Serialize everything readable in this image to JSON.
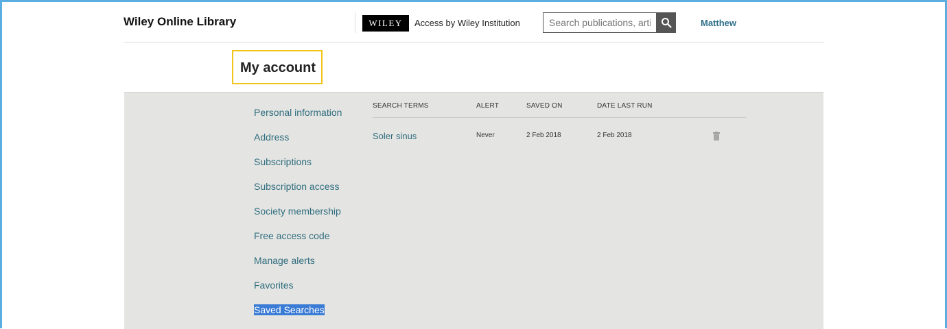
{
  "header": {
    "brand": "Wiley Online Library",
    "logo_text": "WILEY",
    "access_text": "Access by Wiley Institution",
    "search_placeholder": "Search publications, articles",
    "user_name": "Matthew"
  },
  "page": {
    "title": "My account"
  },
  "sidebar": {
    "items": [
      {
        "label": "Personal information"
      },
      {
        "label": "Address"
      },
      {
        "label": "Subscriptions"
      },
      {
        "label": "Subscription access"
      },
      {
        "label": "Society membership"
      },
      {
        "label": "Free access code"
      },
      {
        "label": "Manage alerts"
      },
      {
        "label": "Favorites"
      },
      {
        "label": "Saved Searches"
      }
    ],
    "selected": "Saved Searches"
  },
  "saved_searches": {
    "columns": [
      "SEARCH TERMS",
      "ALERT",
      "SAVED ON",
      "DATE LAST RUN"
    ],
    "rows": [
      {
        "search_terms": "Soler sinus",
        "alert": "Never",
        "saved_on": "2 Feb 2018",
        "date_last_run": "2 Feb 2018",
        "action_icon": "trash-icon"
      }
    ]
  },
  "colors": {
    "frame_border": "#5aaee0",
    "panel_background": "#e4e5e2",
    "link": "#2f6c7e",
    "highlight_box": "#f0c419",
    "selection": "#3a7bd5"
  }
}
